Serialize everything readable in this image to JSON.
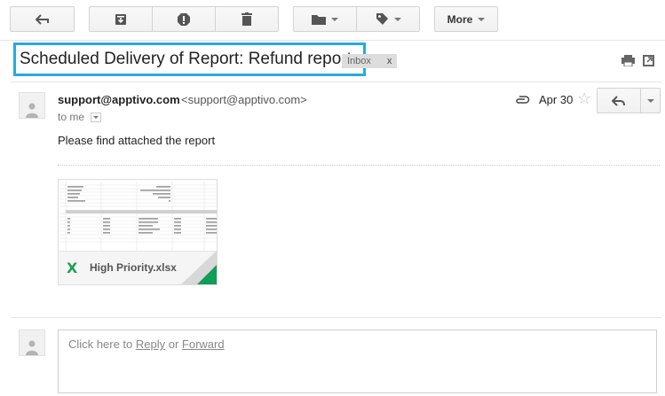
{
  "toolbar": {
    "more_label": "More"
  },
  "subject": "Scheduled Delivery of Report: Refund reports",
  "label_chip": {
    "text": "Inbox",
    "close": "x"
  },
  "message": {
    "sender_name": "support@apptivo.com",
    "sender_email": "<support@apptivo.com>",
    "to_label": "to me",
    "date": "Apr 30",
    "body": "Please find attached the report"
  },
  "attachment": {
    "filename": "High Priority.xlsx"
  },
  "reply_box": {
    "prefix": "Click here to ",
    "reply_link": "Reply",
    "or": " or ",
    "forward_link": "Forward"
  },
  "colors": {
    "highlight_border": "#29a9df",
    "excel_green": "#1e9e55",
    "corner_green": "#0f9d58"
  }
}
